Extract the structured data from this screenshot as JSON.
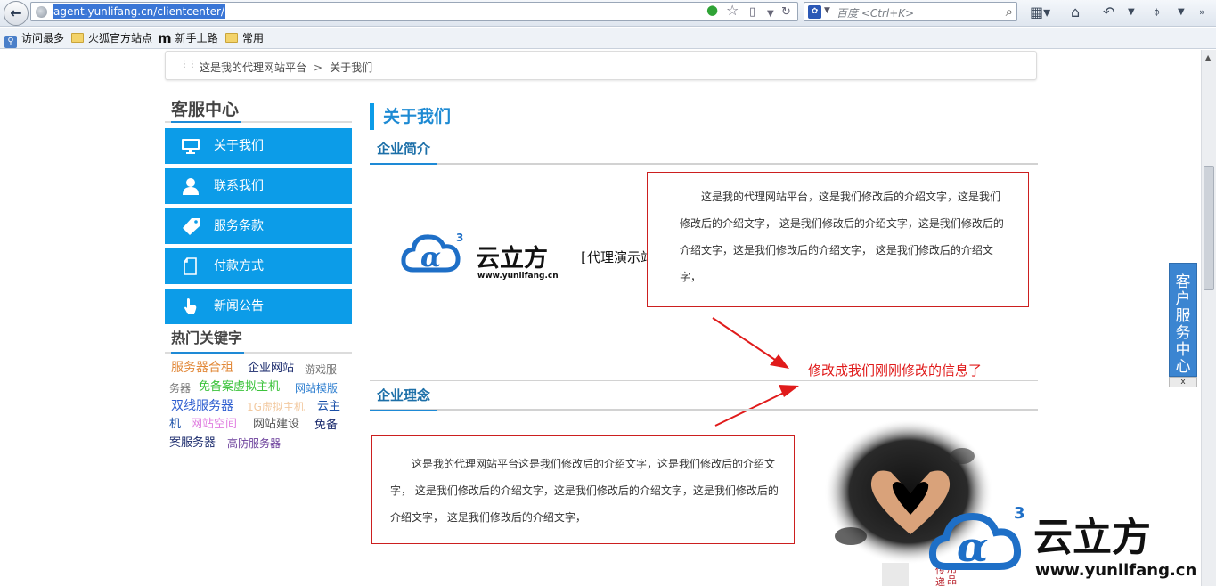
{
  "browser": {
    "url": "agent.yunlifang.cn/clientcenter/",
    "search_placeholder": "百度 <Ctrl+K>",
    "bookmarks": [
      "访问最多",
      "火狐官方站点",
      "新手上路",
      "常用"
    ]
  },
  "breadcrumb": {
    "home": "这是我的代理网站平台",
    "separator": ">",
    "current": "关于我们"
  },
  "sidebar": {
    "title": "客服中心",
    "items": [
      {
        "label": "关于我们",
        "icon": "monitor-icon"
      },
      {
        "label": "联系我们",
        "icon": "user-icon"
      },
      {
        "label": "服务条款",
        "icon": "tag-icon"
      },
      {
        "label": "付款方式",
        "icon": "document-icon"
      },
      {
        "label": "新闻公告",
        "icon": "pointer-hand-icon"
      }
    ]
  },
  "hot_keywords": {
    "title": "热门关键字",
    "items": [
      {
        "text": "服务器合租",
        "color": "#e2893a"
      },
      {
        "text": "企业网站",
        "color": "#1a2a6c"
      },
      {
        "text": "游戏服",
        "color": "#777777"
      },
      {
        "text": "务器",
        "color": "#777777"
      },
      {
        "text": "免备案虚拟主机",
        "color": "#3cc33c"
      },
      {
        "text": "网站模版",
        "color": "#2f7fd0"
      },
      {
        "text": "双线服务器",
        "color": "#2f5fd0"
      },
      {
        "text": "1G虚拟主机",
        "color": "#f2c9a0"
      },
      {
        "text": "云主",
        "color": "#1a50a8"
      },
      {
        "text": "机",
        "color": "#1a50a8"
      },
      {
        "text": "网站空间",
        "color": "#e07ee0"
      },
      {
        "text": "网站建设",
        "color": "#555555"
      },
      {
        "text": "免备",
        "color": "#1a2a6c"
      },
      {
        "text": "案服务器",
        "color": "#1a2a6c"
      },
      {
        "text": "高防服务器",
        "color": "#6a3d9a"
      }
    ]
  },
  "main": {
    "title": "关于我们",
    "section1": {
      "title": "企业简介",
      "text": "这是我的代理网站平台，这是我们修改后的介绍文字，这是我们修改后的介绍文字， 这是我们修改后的介绍文字，这是我们修改后的介绍文字，这是我们修改后的介绍文字， 这是我们修改后的介绍文字，"
    },
    "logo": {
      "brand": "云立方",
      "tagline": "[代理演示站]",
      "site": "www.yunlifang.cn"
    },
    "annotation": "修改成我们刚刚修改的信息了",
    "section2": {
      "title": "企业理念",
      "text": "这是我的代理网站平台这是我们修改后的介绍文字，这是我们修改后的介绍文字， 这是我们修改后的介绍文字，这是我们修改后的介绍文字，这是我们修改后的介绍文字， 这是我们修改后的介绍文字，"
    },
    "ink_caption": [
      "传",
      "用",
      "递",
      "品"
    ]
  },
  "float_service": {
    "label": "客户服务中心",
    "close": "x"
  },
  "colors": {
    "accent": "#0c9ce8",
    "highlight_red": "#e01b1b"
  }
}
